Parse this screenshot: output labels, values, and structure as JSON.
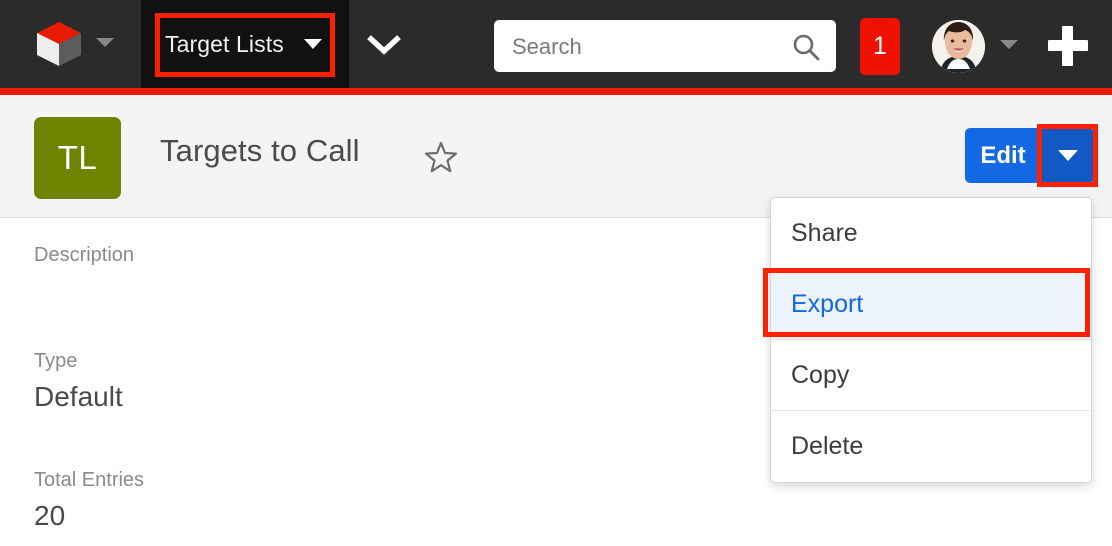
{
  "navbar": {
    "logo_icon": "sugarcrm-cube-logo",
    "logo_caret_icon": "caret-down-icon",
    "module_tab": {
      "label": "Target Lists",
      "caret_icon": "caret-down-icon",
      "highlighted": true
    },
    "overflow_chevron_icon": "chevron-down-icon",
    "search": {
      "placeholder": "Search",
      "value": "",
      "icon": "search-icon"
    },
    "notifications": {
      "count": "1",
      "color": "#ee1100"
    },
    "avatar_icon": "user-avatar-photo",
    "avatar_caret_icon": "caret-down-icon",
    "create_icon": "plus-icon",
    "background": "#2b2b2b",
    "accent_bar_color": "#ec1c00"
  },
  "record_header": {
    "avatar_initials": "TL",
    "avatar_color": "#6d8400",
    "title": "Targets to Call",
    "favorite_icon": "star-outline-icon",
    "edit_button": {
      "label": "Edit",
      "color": "#1269e3",
      "caret_icon": "caret-down-icon",
      "caret_highlighted": true
    }
  },
  "action_menu": {
    "items": [
      {
        "label": "Share",
        "highlighted": false
      },
      {
        "label": "Export",
        "highlighted": true
      },
      {
        "label": "Copy",
        "highlighted": false
      },
      {
        "label": "Delete",
        "highlighted": false
      }
    ],
    "highlight_color": "#edf3fd",
    "highlight_text_color": "#1268e0"
  },
  "details": {
    "description": {
      "label": "Description",
      "value": ""
    },
    "type": {
      "label": "Type",
      "value": "Default"
    },
    "total_entries": {
      "label": "Total Entries",
      "value": "20"
    }
  },
  "annotations": {
    "color": "#ff2000",
    "boxes": [
      "module-tab-highlight",
      "edit-caret-highlight",
      "export-menu-item-highlight"
    ]
  }
}
